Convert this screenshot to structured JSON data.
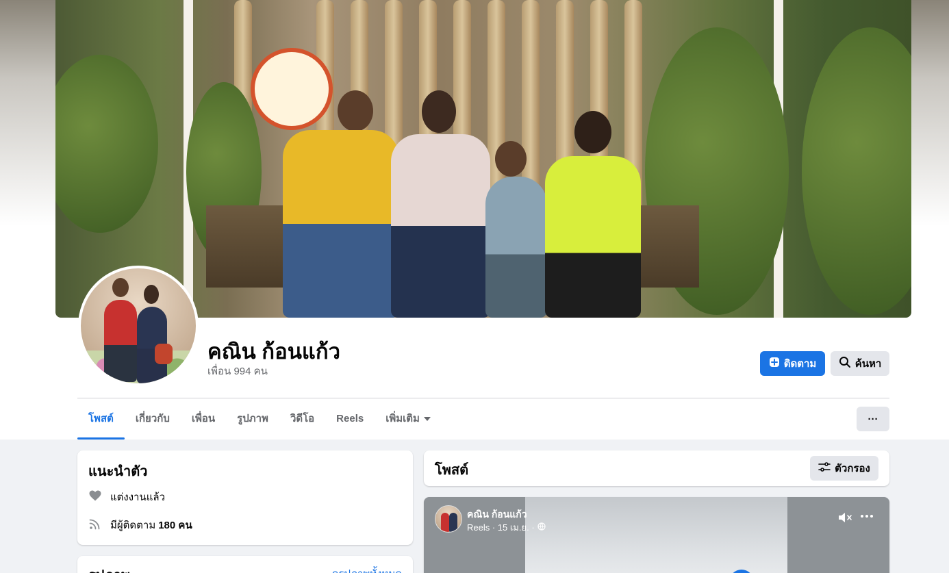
{
  "profile": {
    "name": "คณิน ก้อนแก้ว",
    "friends_count": "เพื่อน 994 คน"
  },
  "actions": {
    "follow_label": "ติดตาม",
    "search_label": "ค้นหา",
    "more_label": "···"
  },
  "tabs": [
    {
      "label": "โพสต์",
      "active": true
    },
    {
      "label": "เกี่ยวกับ",
      "active": false
    },
    {
      "label": "เพื่อน",
      "active": false
    },
    {
      "label": "รูปภาพ",
      "active": false
    },
    {
      "label": "วิดีโอ",
      "active": false
    },
    {
      "label": "Reels",
      "active": false
    },
    {
      "label": "เพิ่มเติม",
      "active": false
    }
  ],
  "intro": {
    "title": "แนะนำตัว",
    "relationship": "แต่งงานแล้ว",
    "followers_prefix": "มีผู้ติดตาม",
    "followers_value": "180 คน"
  },
  "photos": {
    "title": "รูปภาพ",
    "see_all": "ดูรูปภาพทั้งหมด"
  },
  "posts": {
    "title": "โพสต์",
    "filter_label": "ตัวกรอง"
  },
  "post": {
    "author": "คณิน ก้อนแก้ว",
    "meta": "Reels · 15 เม.ย. ·"
  },
  "colors": {
    "accent": "#1b74e4",
    "background": "#f0f2f5",
    "secondary_text": "#65676b"
  },
  "icons": {
    "follow": "person-add-icon",
    "search": "search-icon",
    "dropdown": "chevron-down-icon",
    "relationship": "heart-icon",
    "followers": "rss-feed-icon",
    "filter": "filter-sliders-icon",
    "visibility": "globe-icon",
    "mute": "speaker-muted-icon"
  }
}
